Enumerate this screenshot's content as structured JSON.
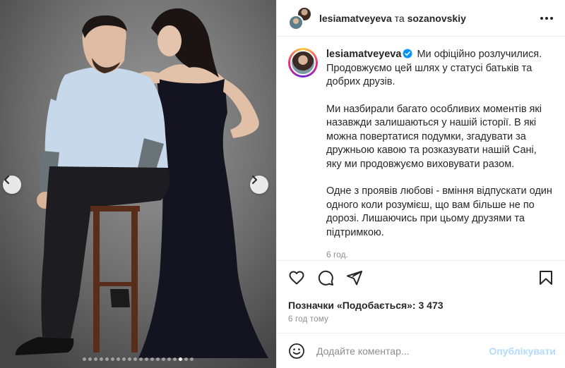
{
  "colors": {
    "accent": "#0095f6",
    "publish_disabled": "#b3dbff",
    "muted_text": "#8e8e8e",
    "border": "#efefef",
    "verified_badge": "#0095f6"
  },
  "carousel": {
    "prev_icon": "chevron-left-icon",
    "next_icon": "chevron-right-icon",
    "dot_count": 20,
    "active_dot": 18
  },
  "header": {
    "author_1": "lesiamatveyeva",
    "joiner": "та",
    "author_2": "sozanovskiy",
    "more_icon": "more-horizontal-icon"
  },
  "caption": {
    "username": "lesiamatveyeva",
    "verified_icon": "verified-badge-icon",
    "first_line": "Ми офіційно розлучилися. Продовжуємо цей шлях у статусі батьків та добрих друзів.",
    "paragraph_2": "Ми назбирали багато особливих моментів які назавжди залишаються у нашій історії. В які можна повертатися подумки, згадувати за дружньою кавою та розказувати нашій Сані, яку ми продовжуємо виховувати разом.",
    "paragraph_3": "Одне з проявів любові - вміння відпускати один одного коли розумієш, що вам більше не по дорозі. Лишаючись при цьому друзями та підтримкою.",
    "time": "6 год."
  },
  "actions": {
    "like_icon": "heart-icon",
    "comment_icon": "comment-icon",
    "share_icon": "send-icon",
    "save_icon": "bookmark-icon"
  },
  "likes": {
    "text": "Позначки «Подобається»: 3 473"
  },
  "post_date": "6 год тому",
  "comment": {
    "emoji_icon": "emoji-icon",
    "placeholder": "Додайте коментар...",
    "publish_label": "Опублікувати"
  }
}
